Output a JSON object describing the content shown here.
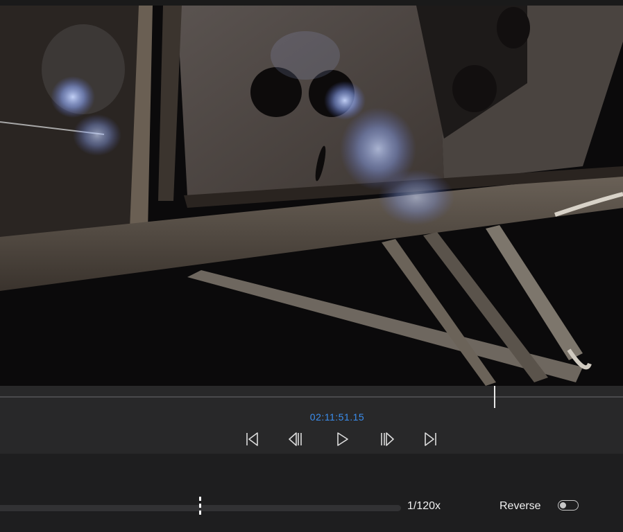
{
  "video": {
    "description_icon": "video-frame"
  },
  "scrubber": {
    "timecode": "02:11:51.15",
    "timecode_color": "#3b8ff0"
  },
  "controls": {
    "icons": [
      "skip-to-start-icon",
      "step-back-icon",
      "play-icon",
      "step-forward-icon",
      "skip-to-end-icon"
    ]
  },
  "speed": {
    "value_label": "1/120x"
  },
  "reverse": {
    "label": "Reverse",
    "enabled": false
  }
}
